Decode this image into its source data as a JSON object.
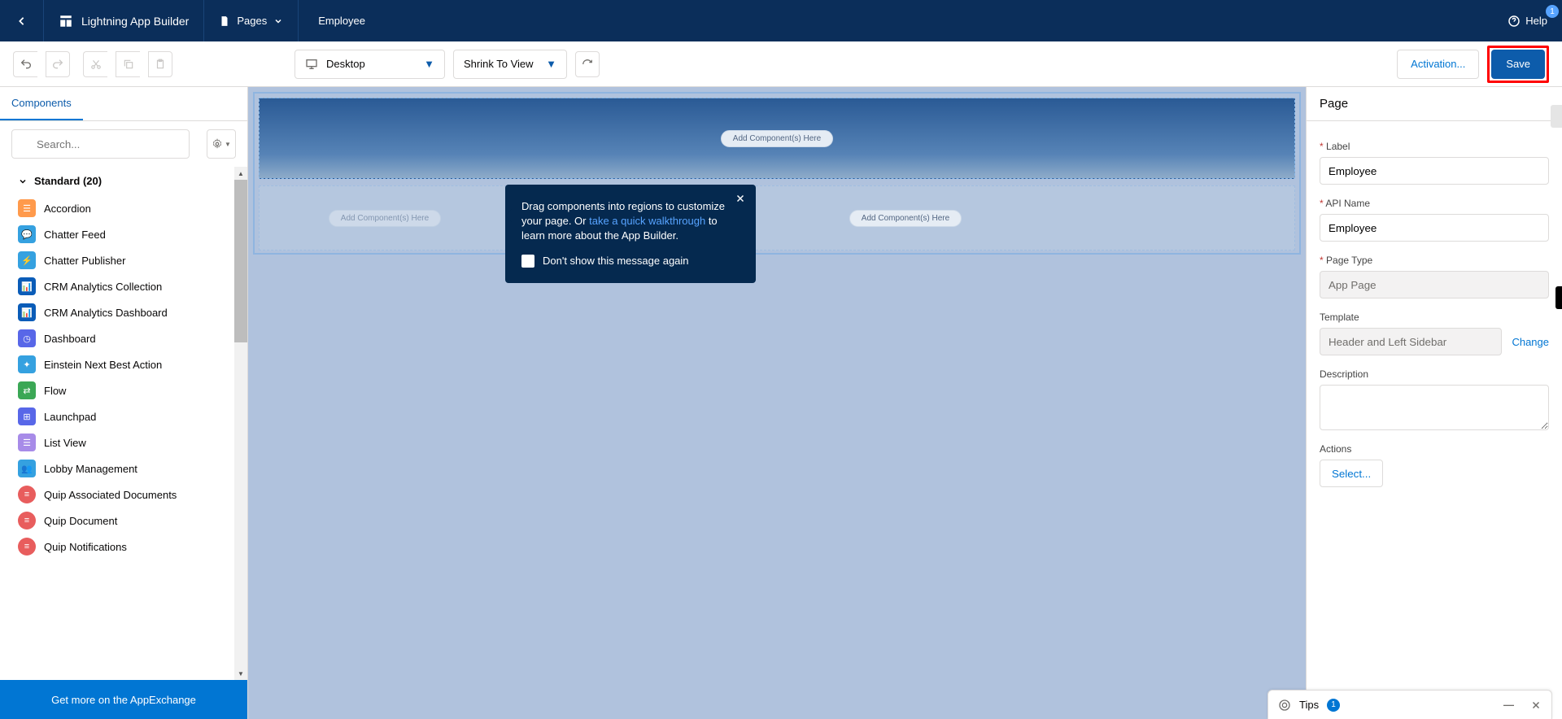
{
  "header": {
    "app_title": "Lightning App Builder",
    "pages_label": "Pages",
    "page_name": "Employee",
    "help_label": "Help",
    "help_badge": "1"
  },
  "actionbar": {
    "device": "Desktop",
    "zoom": "Shrink To View",
    "activation": "Activation...",
    "save": "Save"
  },
  "left": {
    "tab_components": "Components",
    "search_placeholder": "Search...",
    "section": "Standard (20)",
    "items": [
      "Accordion",
      "Chatter Feed",
      "Chatter Publisher",
      "CRM Analytics Collection",
      "CRM Analytics Dashboard",
      "Dashboard",
      "Einstein Next Best Action",
      "Flow",
      "Launchpad",
      "List View",
      "Lobby Management",
      "Quip Associated Documents",
      "Quip Document",
      "Quip Notifications"
    ],
    "appexchange": "Get more on the AppExchange"
  },
  "canvas": {
    "add_here": "Add Component(s) Here"
  },
  "popover": {
    "text1": "Drag components into regions to customize your page. Or ",
    "link": "take a quick walkthrough",
    "text2": " to learn more about the App Builder.",
    "dont_show": "Don't show this message again"
  },
  "right": {
    "title": "Page",
    "label_label": "Label",
    "label_value": "Employee",
    "api_label": "API Name",
    "api_value": "Employee",
    "page_type_label": "Page Type",
    "page_type_value": "App Page",
    "template_label": "Template",
    "template_value": "Header and Left Sidebar",
    "change": "Change",
    "description_label": "Description",
    "actions_label": "Actions",
    "select": "Select..."
  },
  "tips": {
    "label": "Tips",
    "count": "1"
  }
}
